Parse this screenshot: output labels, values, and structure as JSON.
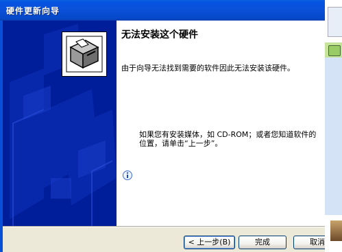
{
  "window": {
    "title": "硬件更新向导"
  },
  "content": {
    "heading": "无法安装这个硬件",
    "message": "由于向导无法找到需要的软件因此无法安装该硬件。",
    "hint_line1": "如果您有安装媒体，如 CD-ROM；或者您知道软件的",
    "hint_line2": "位置，请单击“上一步”。"
  },
  "buttons": {
    "back": "< 上一步(B)",
    "finish": "完成",
    "cancel": "取消"
  },
  "colors": {
    "banner": "#001d9a",
    "titlebar": "#0554e0"
  },
  "icons": [
    "hardware-install-icon",
    "info-icon"
  ]
}
